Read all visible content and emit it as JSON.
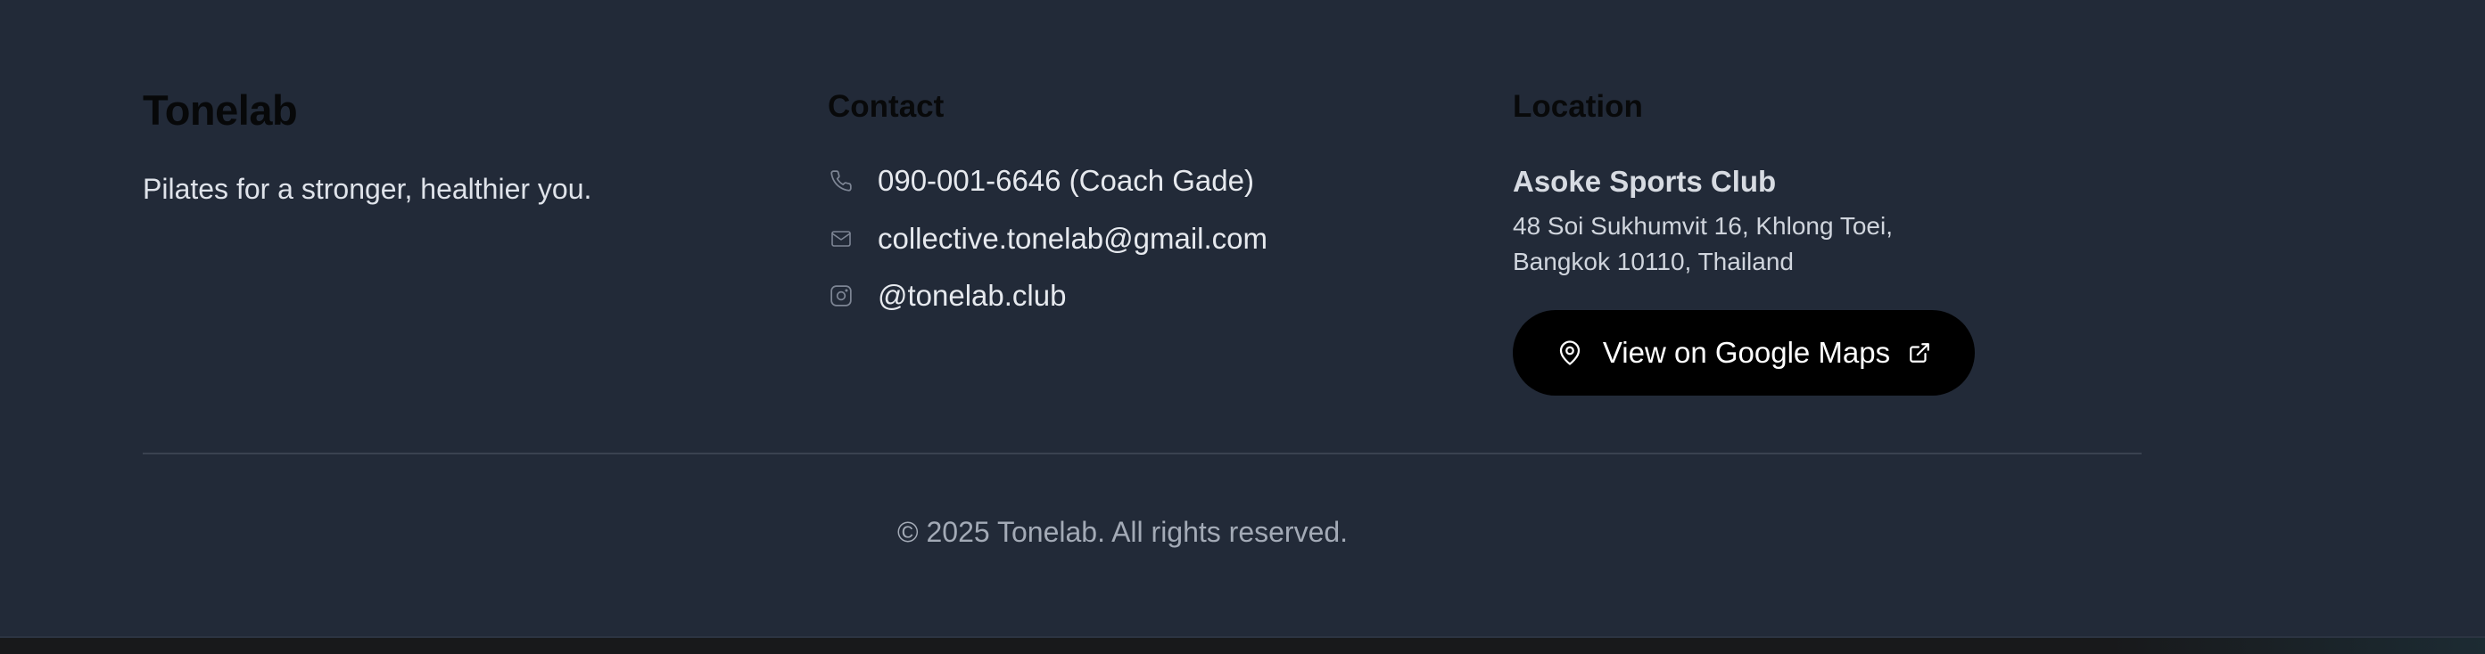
{
  "brand": {
    "name": "Tonelab",
    "tagline": "Pilates for a stronger, healthier you."
  },
  "contact": {
    "heading": "Contact",
    "items": [
      {
        "icon": "phone-icon",
        "text": "090-001-6646 (Coach Gade)"
      },
      {
        "icon": "mail-icon",
        "text": "collective.tonelab@gmail.com"
      },
      {
        "icon": "instagram-icon",
        "text": "@tonelab.club"
      }
    ]
  },
  "location": {
    "heading": "Location",
    "venue": "Asoke Sports Club",
    "address_line1": "48 Soi Sukhumvit 16, Khlong Toei,",
    "address_line2": "Bangkok 10110, Thailand",
    "maps_button": {
      "label": "View on Google Maps",
      "icon": "map-pin-icon",
      "trailing_icon": "external-link-icon"
    }
  },
  "copyright": "© 2025 Tonelab. All rights reserved.",
  "colors": {
    "footer_bg": "#222a38",
    "button_bg": "#000000",
    "muted_text": "#a3aab6"
  }
}
